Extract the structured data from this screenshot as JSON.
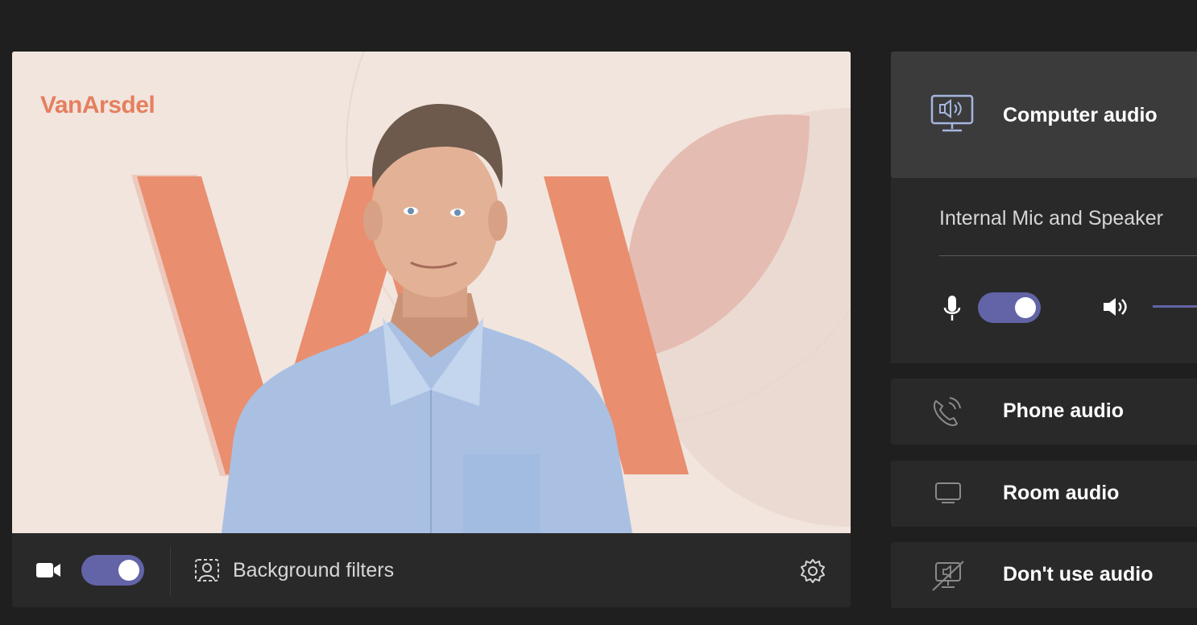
{
  "video": {
    "brand_logo": "VanArsdel",
    "camera_on": true
  },
  "video_controls": {
    "camera_icon": "video-camera-icon",
    "background_filters_label": "Background filters",
    "background_filters_icon": "background-effects-icon",
    "settings_icon": "gear-icon"
  },
  "audio": {
    "computer_audio_label": "Computer audio",
    "computer_audio_icon": "computer-speaker-icon",
    "device_name": "Internal Mic and Speaker",
    "mic_on": true,
    "mic_icon": "microphone-icon",
    "speaker_icon": "speaker-volume-icon",
    "phone_audio_label": "Phone audio",
    "phone_audio_icon": "phone-icon",
    "room_audio_label": "Room audio",
    "room_audio_icon": "room-device-icon",
    "no_audio_label": "Don't use audio",
    "no_audio_icon": "audio-off-icon"
  },
  "colors": {
    "accent": "#6264a7",
    "background": "#1f1f1f",
    "brand": "#e57f5e"
  }
}
